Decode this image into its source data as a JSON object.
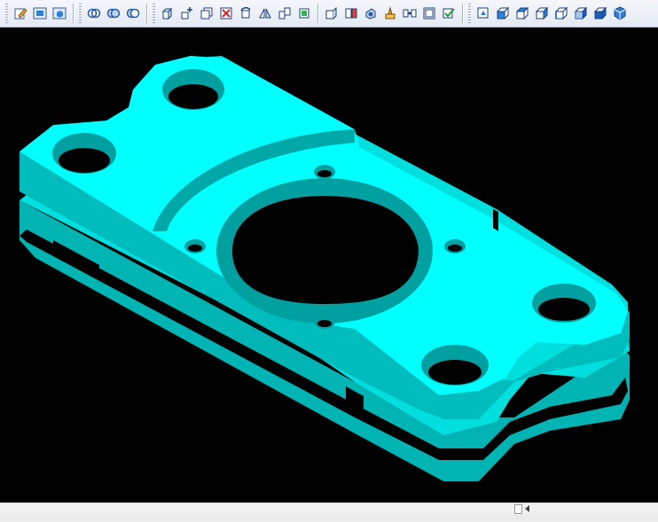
{
  "toolbar": {
    "groups": [
      [
        "edit-icon",
        "fit-all-icon",
        "view-box-icon"
      ],
      [
        "intersect-icon",
        "union-icon",
        "subtract-icon"
      ],
      [
        "box-icon",
        "move-icon",
        "copy-solid-icon",
        "delete-solid-icon",
        "rotate-icon",
        "mirror-icon",
        "align-icon",
        "section-icon",
        "compare-icon",
        "shade-icon",
        "paint-icon",
        "split-icon",
        "hollow-icon",
        "accept-icon"
      ],
      [
        "perspective-icon",
        "view-front-icon",
        "view-top-icon",
        "view-right-icon",
        "view-left-icon",
        "view-back-icon",
        "view-bottom-icon",
        "view-iso-icon"
      ]
    ]
  },
  "viewport": {
    "background": "#000000",
    "model_color": "#00ffff",
    "model_shade_color": "#00b4b4"
  }
}
